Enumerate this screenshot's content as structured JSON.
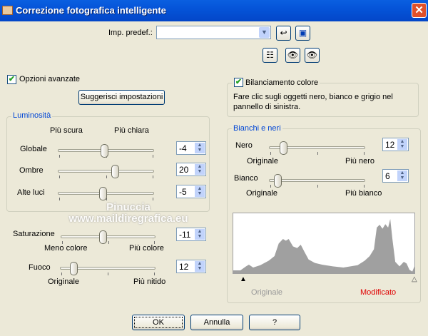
{
  "window": {
    "title": "Correzione fotografica intelligente",
    "close": "✕"
  },
  "presets": {
    "label": "Imp. predef.:",
    "value": ""
  },
  "advanced": {
    "label": "Opzioni avanzate",
    "checked": true
  },
  "suggest_button": "Suggerisci impostazioni",
  "brightness": {
    "legend": "Luminosità",
    "left_label": "Più scura",
    "right_label": "Più chiara",
    "rows": [
      {
        "label": "Globale",
        "value": "-4"
      },
      {
        "label": "Ombre",
        "value": "20"
      },
      {
        "label": "Alte luci",
        "value": "-5"
      }
    ]
  },
  "saturation": {
    "label": "Saturazione",
    "value": "-11",
    "left": "Meno colore",
    "right": "Più colore"
  },
  "focus": {
    "label": "Fuoco",
    "value": "12",
    "left": "Originale",
    "right": "Più nitido"
  },
  "watermark": {
    "line1": "Pinuccia",
    "line2": "www.maildiregrafica.eu"
  },
  "color_balance": {
    "label": "Bilanciamento colore",
    "checked": true,
    "hint": "Fare clic sugli oggetti nero, bianco e grigio nel pannello di sinistra."
  },
  "bw": {
    "legend": "Bianchi e neri",
    "black": {
      "label": "Nero",
      "value": "12",
      "left": "Originale",
      "right": "Più nero"
    },
    "white": {
      "label": "Bianco",
      "value": "6",
      "left": "Originale",
      "right": "Più bianco"
    }
  },
  "histogram": {
    "left_label": "Originale",
    "right_label": "Modificato",
    "right_color": "#e00000",
    "points": [
      [
        0,
        5
      ],
      [
        10,
        5
      ],
      [
        18,
        12
      ],
      [
        22,
        15
      ],
      [
        28,
        10
      ],
      [
        38,
        14
      ],
      [
        50,
        22
      ],
      [
        58,
        30
      ],
      [
        64,
        52
      ],
      [
        70,
        60
      ],
      [
        74,
        57
      ],
      [
        78,
        60
      ],
      [
        84,
        47
      ],
      [
        90,
        44
      ],
      [
        95,
        50
      ],
      [
        100,
        38
      ],
      [
        106,
        24
      ],
      [
        115,
        18
      ],
      [
        125,
        15
      ],
      [
        140,
        12
      ],
      [
        155,
        10
      ],
      [
        165,
        12
      ],
      [
        175,
        14
      ],
      [
        185,
        22
      ],
      [
        192,
        30
      ],
      [
        198,
        42
      ],
      [
        202,
        80
      ],
      [
        206,
        85
      ],
      [
        210,
        78
      ],
      [
        214,
        86
      ],
      [
        218,
        80
      ],
      [
        221,
        95
      ],
      [
        224,
        60
      ],
      [
        228,
        20
      ],
      [
        234,
        12
      ],
      [
        240,
        20
      ],
      [
        244,
        17
      ],
      [
        248,
        6
      ],
      [
        252,
        3
      ],
      [
        255,
        12
      ]
    ]
  },
  "buttons": {
    "ok": "OK",
    "cancel": "Annulla",
    "help": "?"
  }
}
